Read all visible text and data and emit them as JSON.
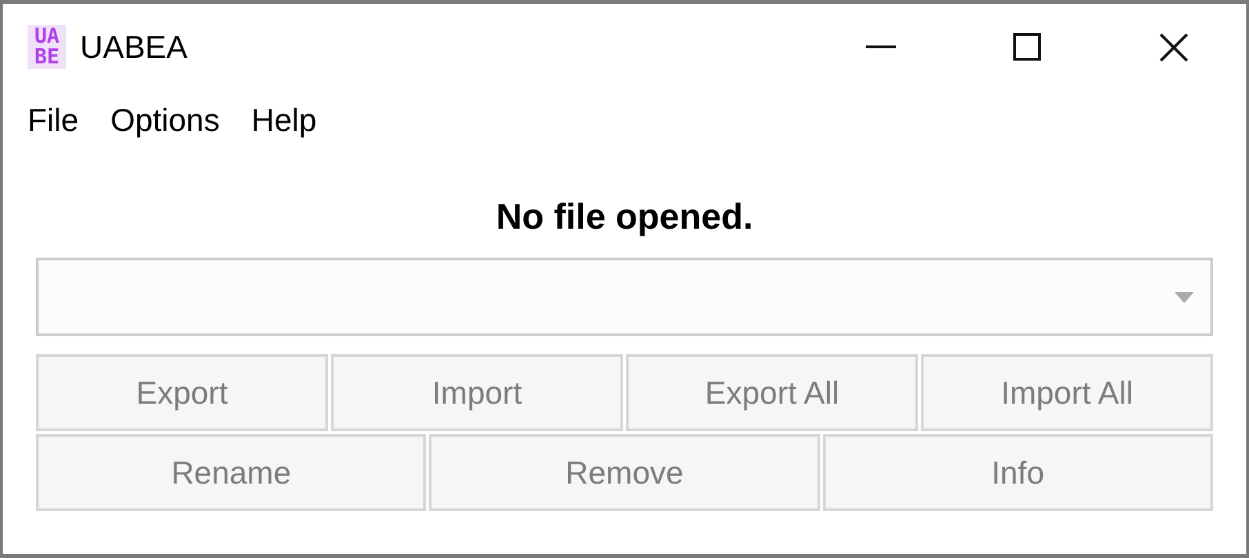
{
  "window": {
    "title": "UABEA",
    "logo_lines": [
      "UA",
      "BE"
    ]
  },
  "menu": [
    "File",
    "Options",
    "Help"
  ],
  "status": "No file opened.",
  "asset_dropdown": {
    "disabled": false
  },
  "button_rows": [
    [
      {
        "label": "Export",
        "disabled": true
      },
      {
        "label": "Import",
        "disabled": true
      },
      {
        "label": "Export All",
        "disabled": true
      },
      {
        "label": "Import All",
        "disabled": true
      }
    ],
    [
      {
        "label": "Rename",
        "disabled": true
      },
      {
        "label": "Remove",
        "disabled": true
      },
      {
        "label": "Info",
        "disabled": true
      }
    ]
  ]
}
